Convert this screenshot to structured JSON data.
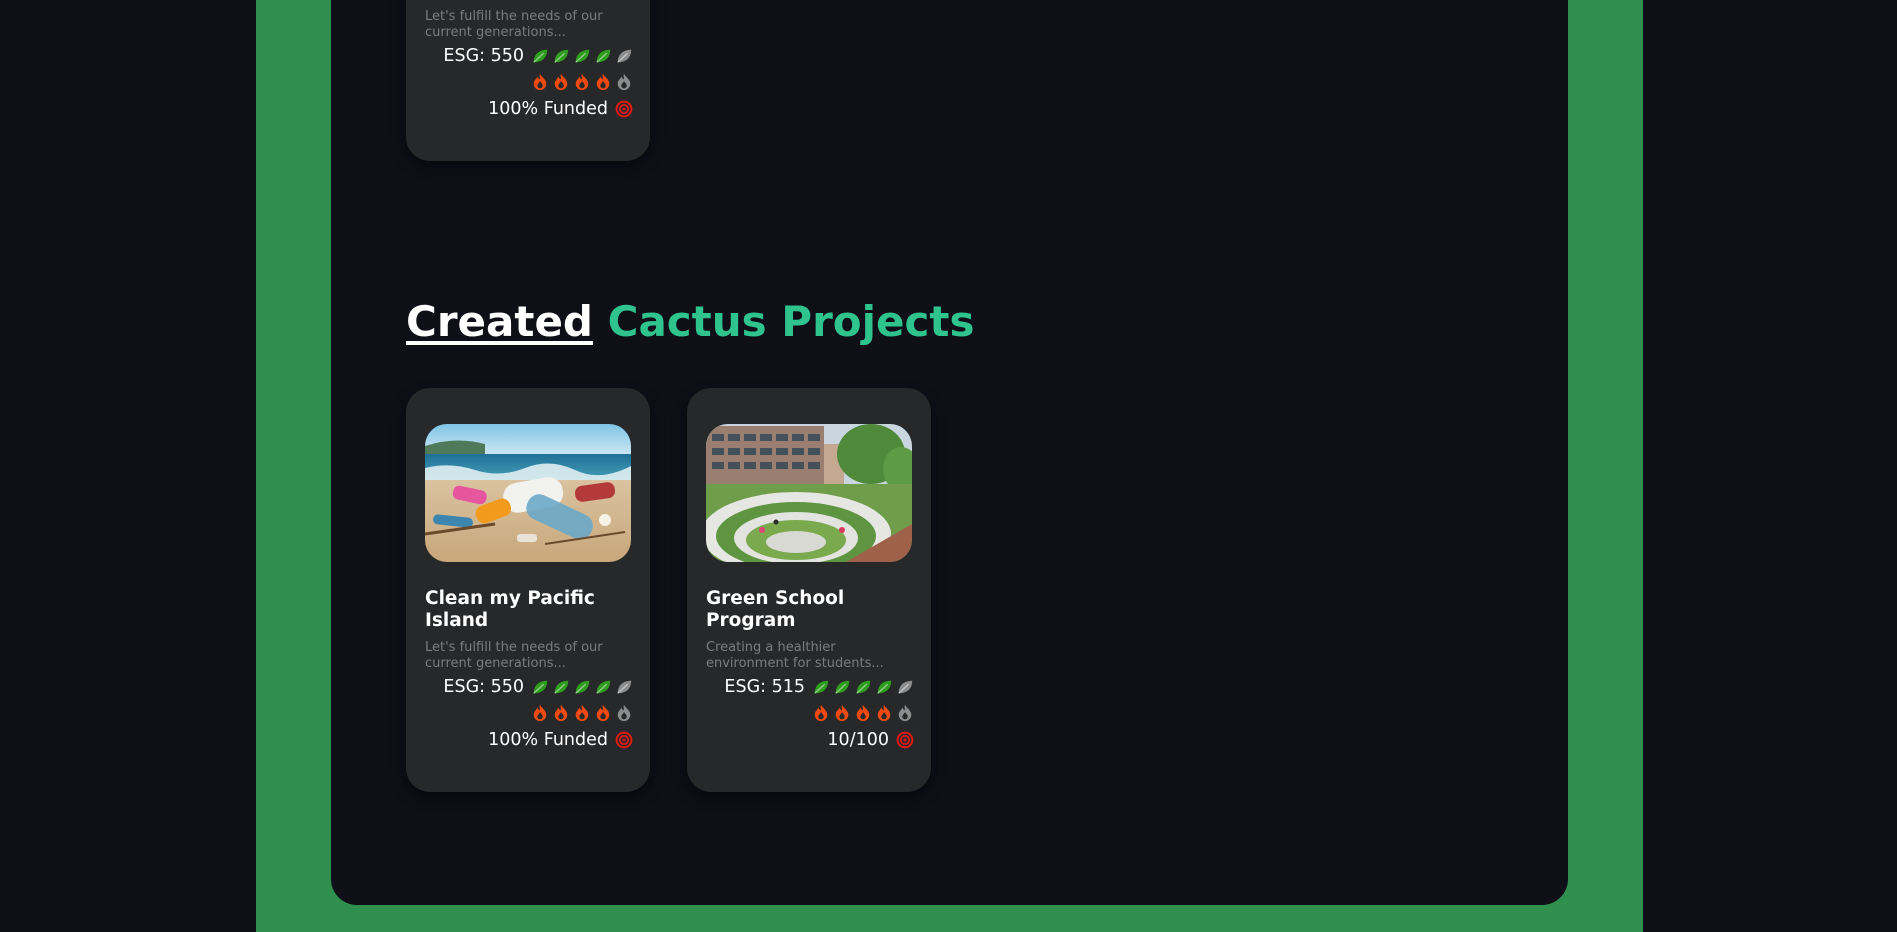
{
  "colors": {
    "page_bg": "#0e0f17",
    "frame_green": "#2e904c",
    "card_bg": "#272829",
    "accent_teal": "#2fc48e",
    "leaf_on": "#2f9e1e",
    "leaf_off": "#8c8c8c",
    "flame_on": "#f04a10",
    "flame_off": "#8c8c8c",
    "target_red": "#e21a12"
  },
  "top_card": {
    "description": "Let's fulfill the needs of our current generations...",
    "esg_label": "ESG: 550",
    "leaf_rating": 4,
    "flame_rating": 4,
    "funding_label": "100% Funded"
  },
  "section": {
    "heading_word1": "Created",
    "heading_word2": "Cactus Projects"
  },
  "projects": [
    {
      "title": "Clean my Pacific Island",
      "description": "Let's fulfill the needs of our current generations...",
      "image": "beach-plastic-pollution-photo",
      "esg_label": "ESG: 550",
      "leaf_rating": 4,
      "flame_rating": 4,
      "funding_label": "100% Funded"
    },
    {
      "title": "Green School Program",
      "description": "Creating a healthier environment for students...",
      "image": "green-school-campus-photo",
      "esg_label": "ESG: 515",
      "leaf_rating": 4,
      "flame_rating": 4,
      "funding_label": "10/100"
    }
  ],
  "rating_max": 5,
  "icons": {
    "leaf": "leaf-icon",
    "flame": "flame-icon",
    "target": "target-icon"
  }
}
